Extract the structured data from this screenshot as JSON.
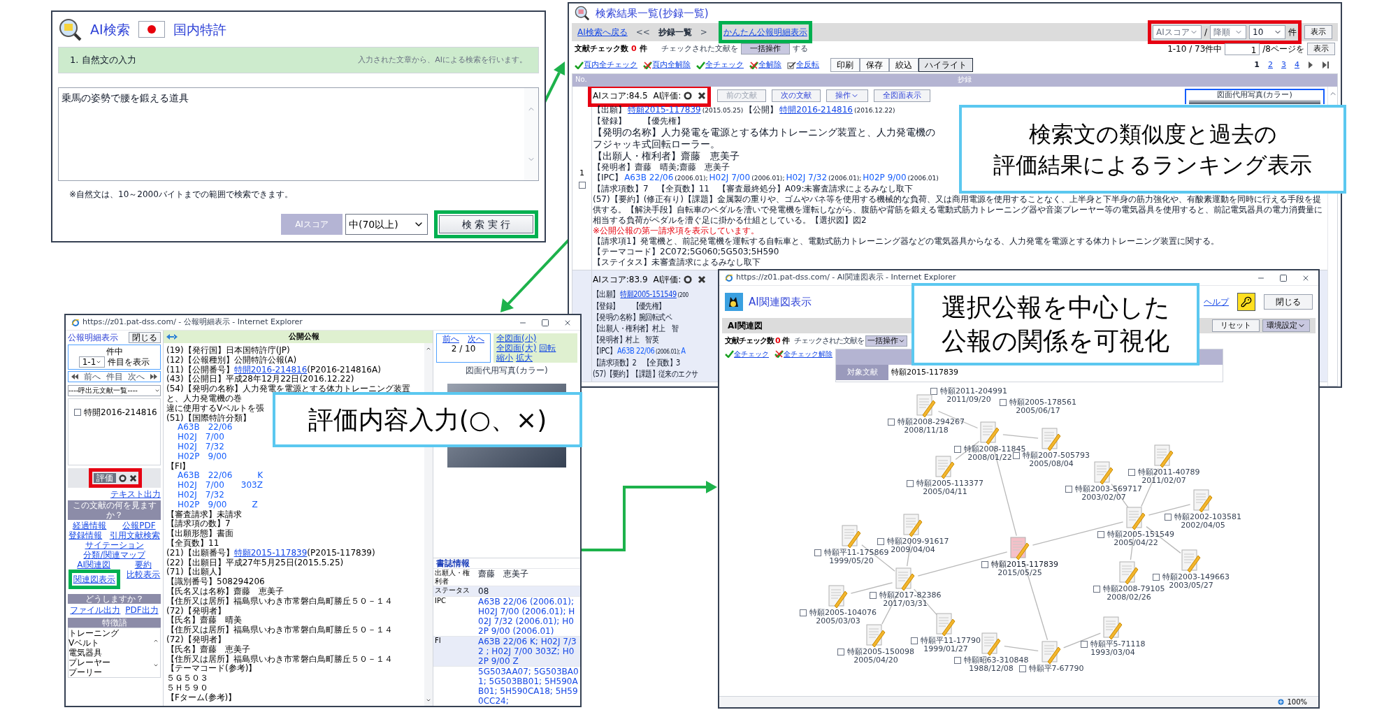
{
  "search_window": {
    "title": "AI検索",
    "scope": "国内特許",
    "step": "1. 自然文の入力",
    "hint": "入力された文章から、AIによる検索を行います。",
    "query": "乗馬の姿勢で腰を鍛える道具",
    "note": "※自然文は、10～2000バイトまでの範囲で検索できます。",
    "score_label": "AIスコア",
    "threshold": "中(70以上)",
    "search_button": "検 索 実 行"
  },
  "results_window": {
    "title": "検索結果一覧(抄録一覧)",
    "breadcrumb": [
      {
        "text": "AI検索へ戻る",
        "kind": "link"
      },
      {
        "text": "<<",
        "kind": "separator"
      },
      {
        "text": "抄録一覧",
        "kind": "current"
      },
      {
        "text": ">",
        "kind": "separator"
      },
      {
        "text": "かんたん公報明細表示",
        "kind": "link"
      }
    ],
    "sort": [
      {
        "value": "AIスコア",
        "disabled": true
      },
      {
        "value": "降順",
        "disabled": true
      },
      {
        "value": "10",
        "disabled": false
      }
    ],
    "sort_separator": "/",
    "sort_unit": "件",
    "sort_button": "表示",
    "check_count": {
      "label": "文献チェック数",
      "value": "0",
      "unit": "件"
    },
    "bulk": {
      "label": "チェックされた文献を",
      "button": "一括操作",
      "suffix": "する"
    },
    "range": {
      "text": "1-10 / 73件中",
      "page": "1",
      "suffix": "/8ページを",
      "button": "表示"
    },
    "check_links": [
      {
        "label": "頁内全チェック",
        "kind": "check"
      },
      {
        "label": "頁内全解除",
        "kind": "uncheck"
      },
      {
        "label": "全チェック",
        "kind": "check"
      },
      {
        "label": "全解除",
        "kind": "uncheck"
      },
      {
        "label": "全反転",
        "kind": "invert"
      }
    ],
    "tools": [
      {
        "label": "印刷",
        "selected": false
      },
      {
        "label": "保存",
        "selected": false
      },
      {
        "label": "絞込",
        "selected": false
      },
      {
        "label": "ハイライト",
        "selected": true
      }
    ],
    "pages": [
      {
        "label": "1",
        "selected": true
      },
      {
        "label": "2",
        "selected": false
      },
      {
        "label": "3",
        "selected": false
      },
      {
        "label": "4",
        "selected": false
      }
    ],
    "columns": [
      "No.",
      "抄録"
    ],
    "records": [
      {
        "no": "1",
        "checked": false,
        "score": "AIスコア:84.5",
        "rating": "AI評価:",
        "figure_title": "図面代用写真(カラー)",
        "buttons": [
          {
            "label": "前の文献",
            "kind": "button",
            "disabled": true
          },
          {
            "label": "次の文献",
            "kind": "button",
            "disabled": false
          },
          {
            "label": "操作",
            "kind": "menu",
            "disabled": false
          },
          {
            "label": "全図面表示",
            "kind": "button",
            "disabled": false
          }
        ],
        "lines": [
          {
            "kind": "body",
            "segments": [
              {
                "text": "【出願】"
              },
              {
                "text": "特願2015-117839",
                "kind": "link"
              },
              {
                "text": "(2015.05.25)",
                "kind": "small"
              },
              {
                "text": "【公開】"
              },
              {
                "text": "特開2016-214816",
                "kind": "link"
              },
              {
                "text": "(2016.12.22)",
                "kind": "small"
              }
            ]
          },
          {
            "kind": "body",
            "segments": [
              {
                "text": "【登録】　　【優先権】"
              }
            ]
          },
          {
            "kind": "main",
            "segments": [
              {
                "text": "【発明の名称】人力発電を電源とする体力トレーニング装置と、人力発電機の"
              }
            ]
          },
          {
            "kind": "main",
            "segments": [
              {
                "text": "フジャッキ式回転ローラー。"
              }
            ]
          },
          {
            "kind": "main",
            "segments": [
              {
                "text": "【出願人・権利者】齋藤　恵美子"
              }
            ]
          },
          {
            "kind": "body",
            "segments": [
              {
                "text": "【発明者】齋藤　晴美;齋藤　恵美子"
              }
            ]
          },
          {
            "kind": "body",
            "segments": [
              {
                "text": "【IPC】"
              },
              {
                "text": "A63B 22/06",
                "kind": "code"
              },
              {
                "text": "(2006.01);",
                "kind": "small"
              },
              {
                "text": "H02J 7/00",
                "kind": "code"
              },
              {
                "text": "(2006.01);",
                "kind": "small"
              },
              {
                "text": "H02J 7/32",
                "kind": "code"
              },
              {
                "text": "(2006.01);",
                "kind": "small"
              },
              {
                "text": "H02P 9/00",
                "kind": "code"
              },
              {
                "text": "(2006.01)",
                "kind": "small"
              }
            ]
          },
          {
            "kind": "body",
            "segments": [
              {
                "text": "【請求項数】7　【全頁数】11　【審査最終処分】A09:未審査請求によるみなし取下"
              }
            ]
          },
          {
            "kind": "body",
            "segments": [
              {
                "text": "(57)【要約】(修正有り)【課題】金属製の重りや、ゴムやバネ等を使用する機械的な負荷、又は商用電源を使用することなく、上半身と下半身の筋力強化や、有酸素運動を同時に行える手段を提供する。【解決手段】自転車のペダルを漕いで発電機を運転しながら、腹筋や背筋を鍛える電動式筋力トレーニング器や音楽プレーヤー等の電気器具を使用すると、前記電気器具の電力消費量に相当する負荷がペダルを漕ぐ足に掛かる仕組としている。【選択図】図2"
              }
            ]
          },
          {
            "kind": "note",
            "segments": [
              {
                "text": "※公開公報の第一請求項を表示しています。"
              }
            ]
          },
          {
            "kind": "body",
            "segments": [
              {
                "text": "【請求項1】発電機と、前記発電機を運転する自転車と、電動式筋力トレーニング器などの電気器具からなる、人力発電を電源とする体力トレーニング装置に関する。"
              }
            ]
          },
          {
            "kind": "body",
            "segments": [
              {
                "text": "【テーマコード】2C072;5G060;5G503;5H590"
              }
            ]
          },
          {
            "kind": "body",
            "segments": [
              {
                "text": "【ステイタス】未審査請求によるみなし取下"
              }
            ]
          }
        ]
      },
      {
        "score": "AIスコア:83.9",
        "rating": "AI評価:",
        "lines": [
          {
            "kind": "compact",
            "segments": [
              {
                "text": "【出願】"
              },
              {
                "text": "特願2005-151549",
                "kind": "link"
              },
              {
                "text": "(200",
                "kind": "small"
              }
            ]
          },
          {
            "kind": "compact",
            "segments": [
              {
                "text": "【登録】　　【優先権】"
              }
            ]
          },
          {
            "kind": "compact",
            "segments": [
              {
                "text": "【発明の名称】腕回転式ペ"
              }
            ]
          },
          {
            "kind": "compact",
            "segments": [
              {
                "text": "【出願人・権利者】村上　智"
              }
            ]
          },
          {
            "kind": "compact",
            "segments": [
              {
                "text": "【発明者】村上　智英"
              }
            ]
          },
          {
            "kind": "compact",
            "segments": [
              {
                "text": "【IPC】"
              },
              {
                "text": "A63B 22/06",
                "kind": "code"
              },
              {
                "text": "(2006.01);",
                "kind": "small"
              },
              {
                "text": "A",
                "kind": "code"
              }
            ]
          },
          {
            "kind": "compact",
            "segments": [
              {
                "text": "【請求項数】2　【全頁数】3"
              }
            ]
          },
          {
            "kind": "compact",
            "segments": [
              {
                "text": "(57)【要約】【課題】従来のエクサ"
              }
            ]
          }
        ]
      }
    ]
  },
  "detail_window": {
    "url": "https://z01.pat-dss.com/ - 公報明細表示 - Internet Explorer",
    "side": {
      "title": "公報明細表示",
      "close": "閉じる",
      "count_label": "件中",
      "range": "1-1",
      "range_suffix": "件目を表示",
      "nav": [
        "前へ",
        "件目",
        "次へ"
      ],
      "source_select": "----呼出元文献一覧----",
      "docs": [
        {
          "label": "特開2016-214816",
          "checked": false
        }
      ],
      "rating_label": "評価",
      "text_link": "テキスト出力",
      "menu_title": "この文献の何を見ますか？",
      "links": [
        "経過情報",
        "公報PDF",
        "登録情報",
        "引用文献検索",
        "サイテーション",
        "分類/関連マップ",
        "AI関連図",
        "要約",
        "関連図表示",
        "比較表示"
      ],
      "action_title": "どうしますか？",
      "actions": [
        "ファイル出力",
        "PDF出力"
      ],
      "keywords_title": "特徴語",
      "keywords": [
        "トレーニング",
        "Vベルト",
        "電気器具",
        "プレーヤー",
        "プーリー"
      ]
    },
    "header": "公開公報",
    "lines": [
      {
        "kind": "text",
        "text": "(19)【発行国】日本国特許庁(JP)"
      },
      {
        "kind": "text",
        "text": "(12)【公報種別】公開特許公報(A)"
      },
      {
        "kind": "link",
        "before": "(11)【公開番号】",
        "link": "特開2016-214816",
        "after": "(P2016-214816A)"
      },
      {
        "kind": "text",
        "text": "(43)【公開日】平成28年12月22日(2016.12.22)"
      },
      {
        "kind": "text",
        "text": "(54)【発明の名称】人力発電を電源とする体力トレーニング装置と、人力発電機の巻"
      },
      {
        "kind": "text",
        "text": "違に使用するVベルトを張"
      },
      {
        "kind": "text",
        "text": "(51)【国際特許分類】"
      },
      {
        "kind": "code",
        "text": "A63B　22/06"
      },
      {
        "kind": "code",
        "text": "H02J　7/00"
      },
      {
        "kind": "code",
        "text": "H02J　7/32"
      },
      {
        "kind": "code",
        "text": "H02P　9/00"
      },
      {
        "kind": "text",
        "text": "【FI】"
      },
      {
        "kind": "code",
        "text": "A63B　22/06　　　K"
      },
      {
        "kind": "code",
        "text": "H02J　7/00　　303Z"
      },
      {
        "kind": "code",
        "text": "H02J　7/32"
      },
      {
        "kind": "code",
        "text": "H02P　9/00　　　Z"
      },
      {
        "kind": "text",
        "text": "【審査請求】未請求"
      },
      {
        "kind": "text",
        "text": "【請求項の数】7"
      },
      {
        "kind": "text",
        "text": "【出願形態】書面"
      },
      {
        "kind": "text",
        "text": "【全頁数】11"
      },
      {
        "kind": "link",
        "before": "(21)【出願番号】",
        "link": "特願2015-117839",
        "after": "(P2015-117839)"
      },
      {
        "kind": "text",
        "text": "(22)【出願日】平成27年5月25日(2015.5.25)"
      },
      {
        "kind": "text",
        "text": "(71)【出願人】"
      },
      {
        "kind": "text",
        "text": "【識別番号】508294206"
      },
      {
        "kind": "text",
        "text": "【氏名又は名称】齋藤　恵美子"
      },
      {
        "kind": "text",
        "text": "【住所又は居所】福島県いわき市常磐白鳥町勝丘５０－１４"
      },
      {
        "kind": "text",
        "text": "(72)【発明者】"
      },
      {
        "kind": "text",
        "text": "【氏名】齋藤　晴美"
      },
      {
        "kind": "text",
        "text": "【住所又は居所】福島県いわき市常磐白鳥町勝丘５０－１４"
      },
      {
        "kind": "text",
        "text": "(72)【発明者】"
      },
      {
        "kind": "text",
        "text": "【氏名】齋藤　恵美子"
      },
      {
        "kind": "text",
        "text": "【住所又は居所】福島県いわき市常磐白鳥町勝丘５０－１４"
      },
      {
        "kind": "text",
        "text": "【テーマコード(参考)】"
      },
      {
        "kind": "text",
        "text": "５Ｇ５０３"
      },
      {
        "kind": "text",
        "text": "５Ｈ５９０"
      },
      {
        "kind": "text",
        "text": "【Fターム(参考)】"
      }
    ],
    "viewer": {
      "prev": "前へ",
      "next": "次へ",
      "page": "2 / 10",
      "links": [
        "全図面(小)",
        "全図面(大)",
        "回転",
        "縮小",
        "拡大"
      ],
      "figure_title": "図面代用写真(カラー)"
    },
    "biblio": {
      "title": "書誌情報",
      "rows": [
        {
          "label": "出願人・権利者",
          "value": "齋藤　恵美子"
        },
        {
          "label": "ステータス",
          "value": "08"
        },
        {
          "label": "IPC",
          "value": "A63B 22/06 (2006.01); H02J 7/00 (2006.01); H02J 7/32 (2006.01); H02P 9/00 (2006.01)"
        },
        {
          "label": "FI",
          "value": "A63B 22/06 K; H02J 7/32 ; H02J 7/00 303Z; H02P 9/00 Z"
        },
        {
          "value": "5G503AA07; 5G503BA01; 5G503BB01; 5H590AB01; 5H590CA18; 5H590CC24;"
        }
      ]
    }
  },
  "relation_window": {
    "url": "https://z01.pat-dss.com/ - AI関連図表示 - Internet Explorer",
    "title": "AI関連図表示",
    "help": "ヘルプ",
    "close": "閉じる",
    "section": "AI関連図",
    "section_buttons": [
      {
        "label": "リセット",
        "kind": "button"
      },
      {
        "label": "環境設定",
        "kind": "menu"
      }
    ],
    "check_count": {
      "label": "文献チェック数",
      "value": "0",
      "unit": "件"
    },
    "bulk": {
      "label": "チェックされた文献を",
      "button": "一括操作"
    },
    "check_links": [
      {
        "label": "全チェック",
        "kind": "check"
      },
      {
        "label": "全チェック解除",
        "kind": "uncheck"
      }
    ],
    "target": {
      "label": "対象文献",
      "value": "特願2015-117839"
    },
    "graph": {
      "center": {
        "number": "特願2015-117839",
        "date": "2015/05/25",
        "checked": false,
        "selected": true,
        "children": [
          {
            "number": "特願2008-11845",
            "date": "2008/01/22",
            "checked": false,
            "selected": false,
            "children": [
              {
                "number": "特願2011-204991",
                "date": "2011/09/20",
                "checked": false,
                "selected": false
              },
              {
                "number": "特願2005-178561",
                "date": "2005/06/17",
                "checked": false,
                "selected": false
              },
              {
                "number": "特願2008-294267",
                "date": "2008/11/18",
                "checked": false,
                "selected": false
              },
              {
                "number": "特願2007-505793",
                "date": "2005/08/04",
                "checked": false,
                "selected": false
              },
              {
                "number": "特願2005-113377",
                "date": "2005/04/11",
                "checked": false,
                "selected": false
              }
            ]
          },
          {
            "number": "特願2005-151549",
            "date": "2005/04/22",
            "checked": false,
            "selected": false,
            "children": [
              {
                "number": "特願2011-40789",
                "date": "2011/02/07",
                "checked": false,
                "selected": false
              },
              {
                "number": "特願2003-569717",
                "date": "2003/02/07",
                "checked": false,
                "selected": false
              },
              {
                "number": "特願2002-103581",
                "date": "2002/04/05",
                "checked": false,
                "selected": false
              },
              {
                "number": "特願2003-149663",
                "date": "2003/05/27",
                "checked": false,
                "selected": false
              },
              {
                "number": "特願2008-79105",
                "date": "2008/02/26",
                "checked": false,
                "selected": false
              }
            ]
          },
          {
            "number": "特願2017-82386",
            "date": "2017/03/31",
            "checked": false,
            "selected": false,
            "children": [
              {
                "number": "特願2009-91617",
                "date": "2009/04/04",
                "checked": false,
                "selected": false
              },
              {
                "number": "特願平11-175869",
                "date": "1999/05/20",
                "checked": false,
                "selected": false
              },
              {
                "number": "特願2005-104076",
                "date": "2005/03/03",
                "checked": false,
                "selected": false
              },
              {
                "number": "特願2005-150098",
                "date": "2005/04/20",
                "checked": false,
                "selected": false
              },
              {
                "number": "特願平11-17790",
                "date": "1999/01/27",
                "checked": false,
                "selected": false
              }
            ]
          },
          {
            "number": "特願平7-67790",
            "checked": false,
            "selected": false,
            "children": [
              {
                "number": "特願昭63-310848",
                "date": "1988/12/08",
                "checked": false,
                "selected": false
              },
              {
                "number": "特願平5-71118",
                "date": "1993/03/04",
                "checked": false,
                "selected": false
              }
            ]
          }
        ]
      }
    },
    "zoom": "100%"
  },
  "callouts": [
    {
      "lines": [
        "検索文の類似度と過去の",
        "評価結果によるランキング表示"
      ]
    },
    {
      "lines": [
        "評価内容入力(○、×)"
      ]
    },
    {
      "lines": [
        "選択公報を中心した",
        "公報の関係を可視化"
      ]
    }
  ],
  "highlight_frames": [
    {
      "color": "#00b050"
    },
    {
      "color": "#00b050"
    },
    {
      "color": "#e60012"
    },
    {
      "color": "#e60012"
    },
    {
      "color": "#e60012"
    },
    {
      "color": "#00b050"
    }
  ]
}
